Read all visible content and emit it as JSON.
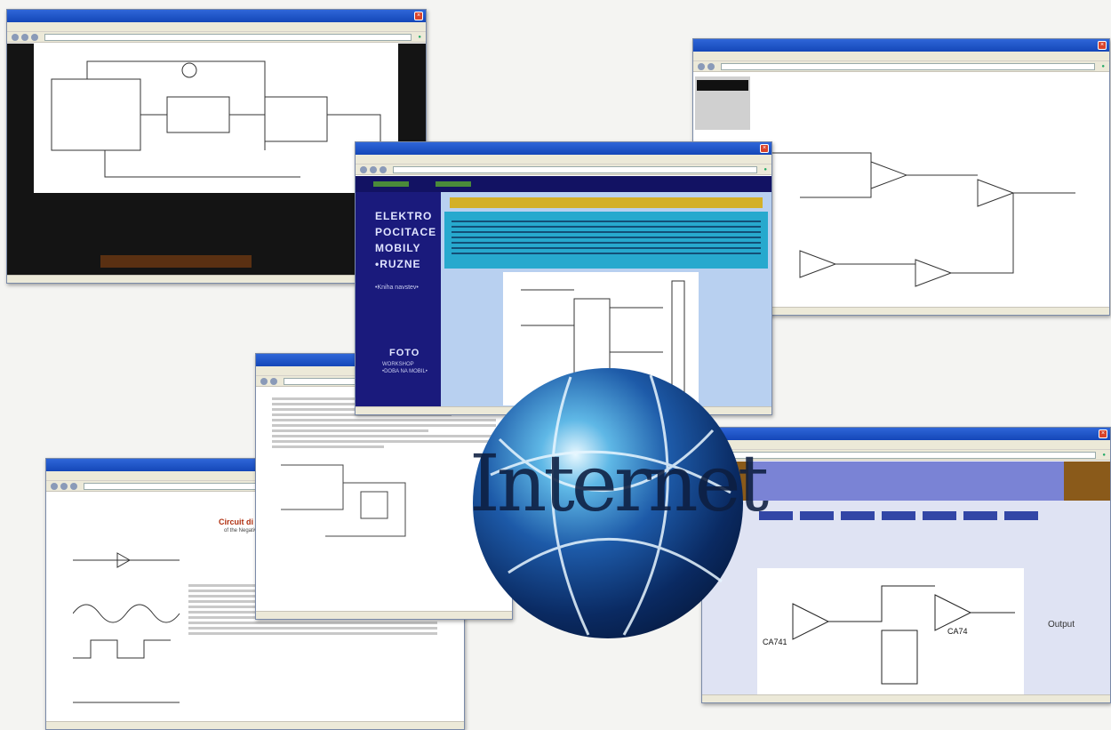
{
  "banner_word": "Internet",
  "window_controls": {
    "close": "×"
  },
  "site_center": {
    "nav_items": [
      "ELEKTRO",
      "POCITACE",
      "MOBILY",
      "RUZNE"
    ],
    "bullet": "•",
    "link_small": "•Kniha navstev•",
    "foto": "FOTO",
    "foto_sub": [
      "WORKSHOP",
      "•DOBA NA MOBIL•"
    ]
  },
  "doc_left": {
    "heading": "Circuit di",
    "subheading": "of the Negative"
  },
  "site_right": {
    "labels": {
      "left_opamp": "CA741",
      "right_opamp": "CA74",
      "output": "Output"
    }
  },
  "colors": {
    "center_bg": "#151565",
    "center_cyan": "#27a9ce",
    "center_header": "#d3b028",
    "right_banner": "#7a83d5",
    "right_nav": "#3246a6",
    "heading_red": "#b03010"
  },
  "icons": [
    "globe-icon",
    "close-icon"
  ]
}
